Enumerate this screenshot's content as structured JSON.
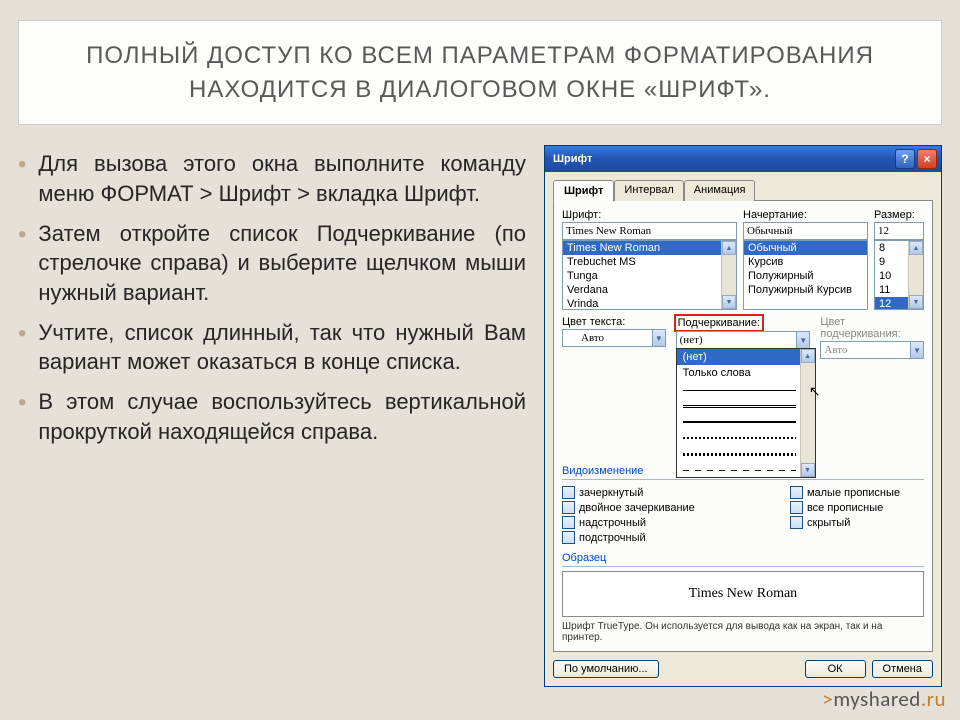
{
  "title": "ПОЛНЫЙ ДОСТУП КО ВСЕМ ПАРАМЕТРАМ ФОРМАТИРОВАНИЯ НАХОДИТСЯ В ДИАЛОГОВОМ ОКНЕ «ШРИФТ».",
  "bullets": [
    "Для вызова этого окна выполните команду меню ФОРМАТ > Шрифт > вкладка Шрифт.",
    "Затем откройте список Подчеркивание (по стрелочке справа) и выберите щелчком мыши нужный вариант.",
    "Учтите, список длинный, так что нужный Вам вариант может оказаться в конце списка.",
    "В этом случае воспользуйтесь вертикальной прокруткой находящейся справа."
  ],
  "dialog": {
    "title": "Шрифт",
    "tabs": [
      "Шрифт",
      "Интервал",
      "Анимация"
    ],
    "labels": {
      "font": "Шрифт:",
      "style": "Начертание:",
      "size": "Размер:",
      "text_color": "Цвет текста:",
      "underline": "Подчеркивание:",
      "underline_color": "Цвет подчеркивания:",
      "effects": "Видоизменение",
      "sample": "Образец"
    },
    "font_value": "Times New Roman",
    "font_list": [
      "Times New Roman",
      "Trebuchet MS",
      "Tunga",
      "Verdana",
      "Vrinda"
    ],
    "style_value": "Обычный",
    "style_list": [
      "Обычный",
      "Курсив",
      "Полужирный",
      "Полужирный Курсив"
    ],
    "size_value": "12",
    "size_list": [
      "8",
      "9",
      "10",
      "11",
      "12"
    ],
    "text_color_value": "Авто",
    "underline_value": "(нет)",
    "underline_options_text": [
      "(нет)",
      "Только слова"
    ],
    "underline_color_value": "Авто",
    "checks_left": [
      "зачеркнутый",
      "двойное зачеркивание",
      "надстрочный",
      "подстрочный"
    ],
    "checks_right": [
      "малые прописные",
      "все прописные",
      "скрытый"
    ],
    "preview_text": "Times New Roman",
    "hint": "Шрифт TrueType. Он используется для вывода как на экран, так и на принтер.",
    "buttons": {
      "default": "По умолчанию...",
      "ok": "ОК",
      "cancel": "Отмена"
    }
  },
  "footer": {
    "text": "myshared",
    "suffix": ".ru"
  }
}
